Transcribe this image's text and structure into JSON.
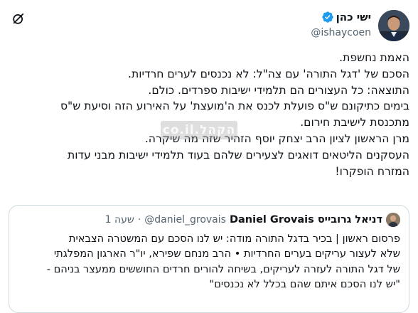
{
  "author": {
    "name": "ישי כהן",
    "handle": "@ishaycoen",
    "verified_color": "#1d9bf0"
  },
  "icons": {
    "verified": "verified-badge-icon",
    "grok": "grok-icon"
  },
  "tweet": {
    "lines": [
      "האמת נחשפת.",
      "הסכם של 'דגל התורה' עם צה\"ל: לא נכנסים לערים חרדיות.",
      "התוצאה: כל העצורים הם תלמידי ישיבות ספרדים. כולם.",
      "בימים כתיקונם ש\"ס פועלת לכנס את ה'מועצת' על האירוע הזה וסיעת ש\"ס",
      "מתכנסת לישיבת חירום.",
      "מרן הראשון לציון הרב יצחק יוסף הזהיר שזה מה שיקרה.",
      "העסקנים הליטאים דואגים לצעירים שלהם בעוד תלמידי ישיבות מבני עדות",
      "המזרח הופקרו!"
    ]
  },
  "watermark": {
    "text": "הקהל.co.il"
  },
  "quote": {
    "name": "דניאל גרובייס Daniel Grovais",
    "handle": "@daniel_grovais",
    "separator": "·",
    "time": "שעה 1",
    "lines": [
      "פרסום ראשון | בכיר בדגל התורה מודה: יש לנו הסכם עם המשטרה הצבאית",
      "שלא לעצור עריקים בערים החרדיות • הרב מנחם שפירא, יו\"ר הארגון המפלגתי",
      "של דגל התורה לעזרה לעריקים, בשיחה להורים חרדים החוששים ממעצר בניהם -",
      "\"יש לנו הסכם איתם שהם בכלל לא נכנסים\""
    ]
  }
}
